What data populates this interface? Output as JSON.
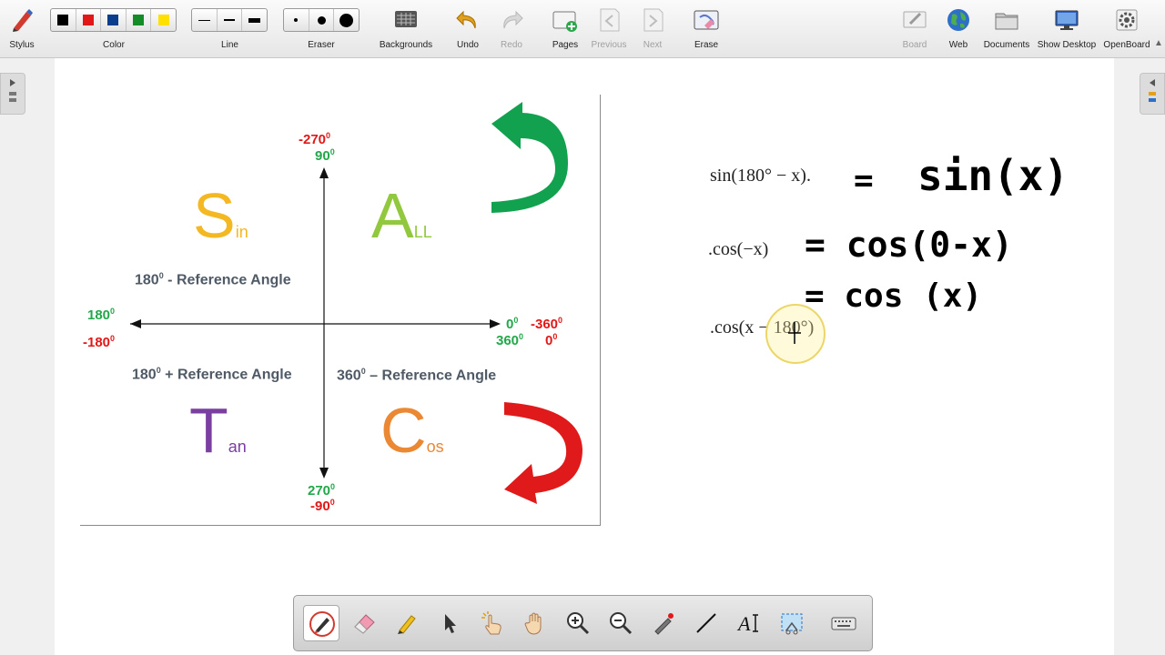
{
  "toolbar": {
    "stylus": "Stylus",
    "color": "Color",
    "line": "Line",
    "eraser": "Eraser",
    "backgrounds": "Backgrounds",
    "undo": "Undo",
    "redo": "Redo",
    "pages": "Pages",
    "previous": "Previous",
    "next": "Next",
    "erase": "Erase",
    "board": "Board",
    "web": "Web",
    "documents": "Documents",
    "show_desktop": "Show Desktop",
    "openboard": "OpenBoard",
    "colors": [
      "#000000",
      "#e21818",
      "#0a3e8c",
      "#148c28",
      "#ffe000"
    ]
  },
  "diagram": {
    "top_red": "-270",
    "top_green": "90",
    "left_green": "180",
    "left_red": "-180",
    "right_green_a": "0",
    "right_red_a": "-360",
    "right_green_b": "360",
    "right_red_b": "0",
    "bottom_green": "270",
    "bottom_red": "-90",
    "deg": "0",
    "q2_rule": "180",
    "q2_rule_text": " - Reference Angle",
    "q3_rule": "180",
    "q3_rule_text": " + Reference Angle",
    "q4_rule": "360",
    "q4_rule_text": " – Reference Angle",
    "sin_big": "S",
    "sin_small": "in",
    "all_big": "A",
    "all_small": "LL",
    "tan_big": "T",
    "tan_small": "an",
    "cos_big": "C",
    "cos_small": "os",
    "colors": {
      "sin": "#f3b822",
      "all": "#92c83e",
      "tan": "#7b3fa2",
      "cos": "#ea8834",
      "arrow_top": "#12a14e",
      "arrow_bottom": "#e01a1a"
    }
  },
  "equations": {
    "eq1": "sin(180° − x).",
    "eq2": ".cos(−x)",
    "eq3": ".cos(x − 180°)",
    "hw1_eq": "=",
    "hw1": "sin(x)",
    "hw2": "= cos(0-x)",
    "hw3": "= cos (x)"
  }
}
